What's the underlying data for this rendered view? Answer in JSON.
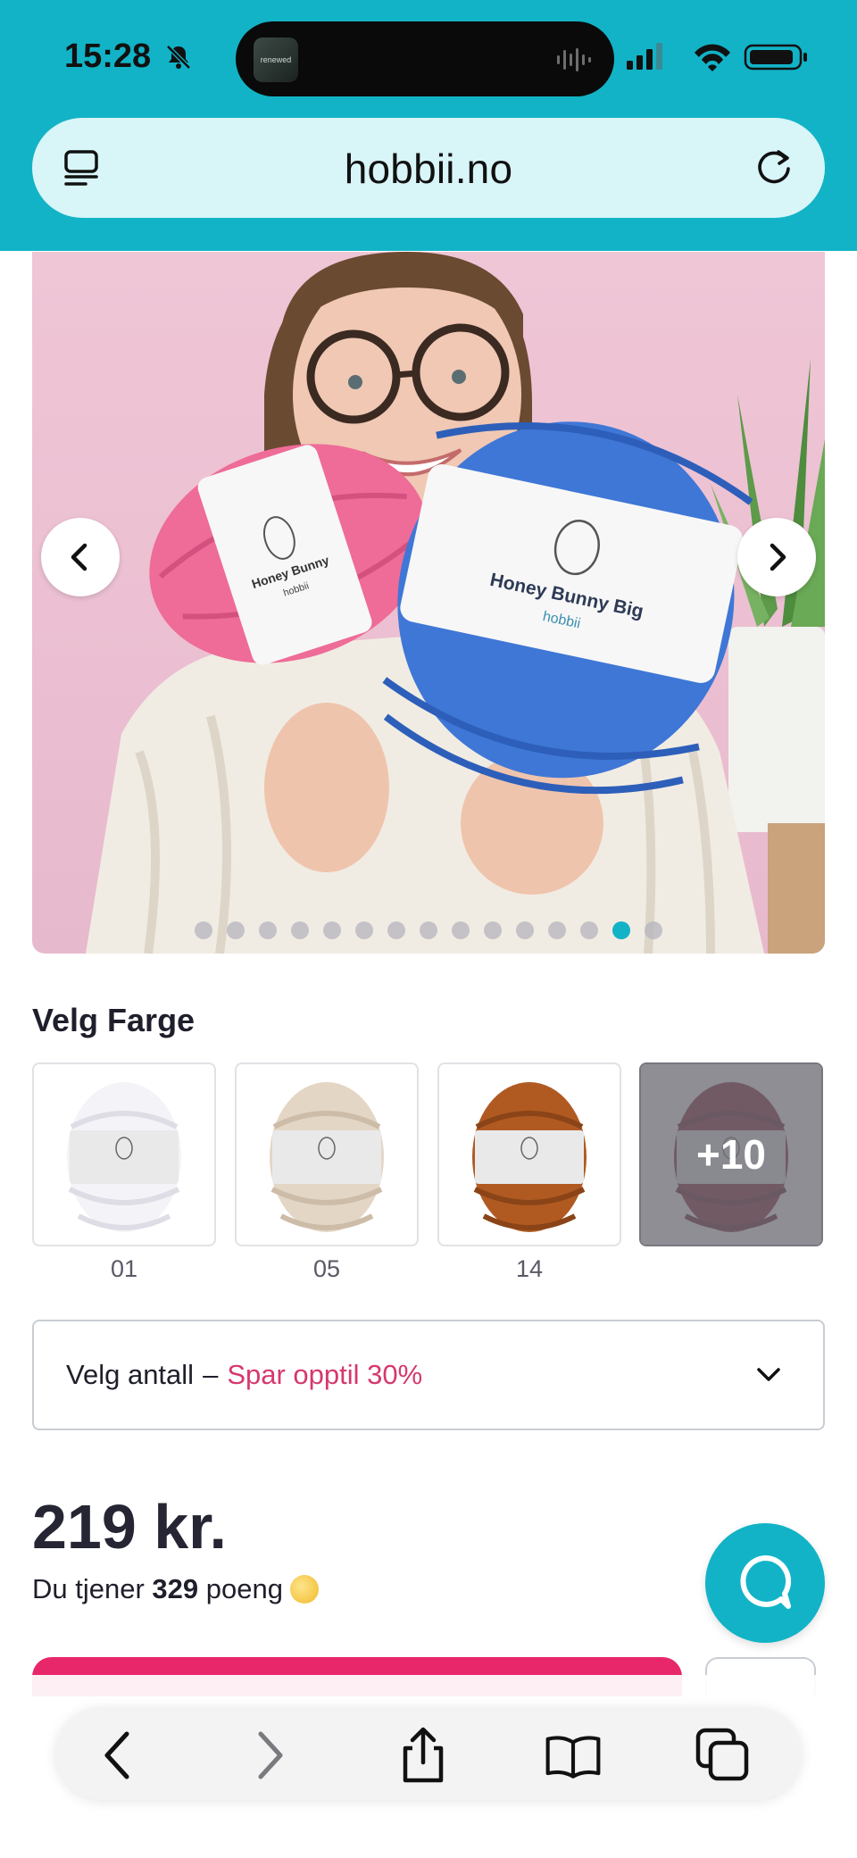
{
  "status_bar": {
    "time": "15:28",
    "island_thumb_text": "renewed"
  },
  "browser": {
    "url": "hobbii.no"
  },
  "product_image": {
    "yarn_left_label": "Honey Bunny",
    "yarn_left_brand": "hobbii",
    "yarn_right_label": "Honey Bunny Big",
    "yarn_right_brand": "hobbii",
    "dot_count": 15,
    "active_dot_index": 13
  },
  "color_picker": {
    "title": "Velg Farge",
    "swatches": [
      {
        "label": "01",
        "color": "#f4f3f7",
        "shade": "#dedde6"
      },
      {
        "label": "05",
        "color": "#e4d6c5",
        "shade": "#cdbca7"
      },
      {
        "label": "14",
        "color": "#b05a22",
        "shade": "#8a4417"
      }
    ],
    "more": {
      "label": "+10",
      "color": "#7d1628"
    }
  },
  "quantity": {
    "label": "Velg antall",
    "separator": "–",
    "promo": "Spar opptil 30%"
  },
  "price": {
    "amount": "219 kr.",
    "points_prefix": "Du tjener",
    "points_value": "329",
    "points_suffix": "poeng"
  },
  "colors": {
    "accent": "#12b3c7",
    "cta": "#e8266a",
    "promo": "#d6386d"
  },
  "toolbar": {
    "icons": [
      "back-icon",
      "forward-icon",
      "share-icon",
      "bookmarks-icon",
      "tabs-icon"
    ]
  }
}
